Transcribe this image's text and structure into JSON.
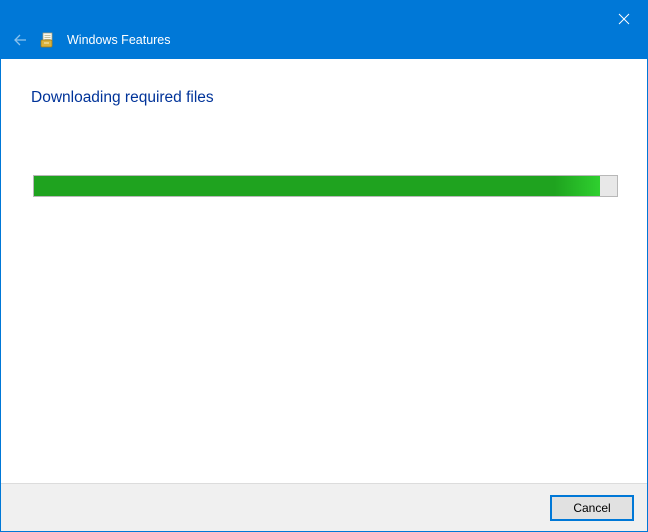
{
  "titlebar": {
    "app_title": "Windows Features"
  },
  "content": {
    "heading": "Downloading required files",
    "progress_percent": 97
  },
  "buttons": {
    "cancel": "Cancel"
  },
  "colors": {
    "accent": "#0078d7",
    "heading": "#003399",
    "progress": "#1fa31f"
  }
}
